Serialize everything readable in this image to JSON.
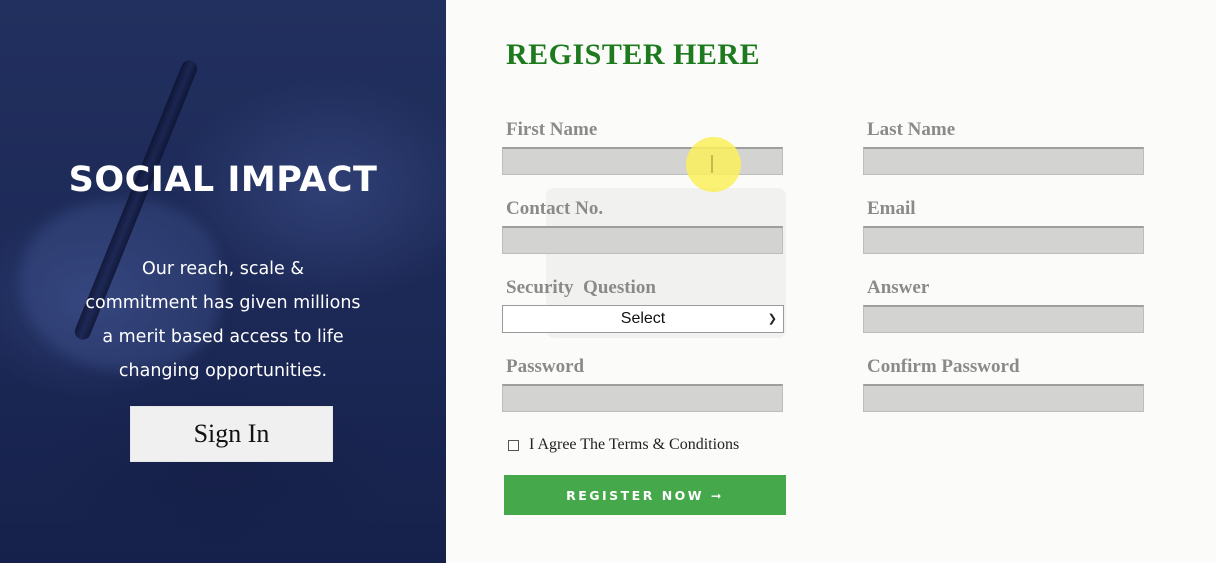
{
  "left_panel": {
    "title": "SOCIAL IMPACT",
    "tagline_lines": [
      "Our reach, scale &",
      "commitment has given millions",
      "a merit based access to life",
      "changing opportunities."
    ],
    "signin_label": "Sign In"
  },
  "form": {
    "heading": "REGISTER HERE",
    "fields": {
      "first_name": {
        "label": "First Name",
        "value": ""
      },
      "last_name": {
        "label": "Last Name",
        "value": ""
      },
      "contact": {
        "label": "Contact No.",
        "value": ""
      },
      "email": {
        "label": "Email",
        "value": ""
      },
      "security_question": {
        "label": "Security  Question",
        "selected": "Select"
      },
      "answer": {
        "label": "Answer",
        "value": ""
      },
      "password": {
        "label": "Password",
        "value": ""
      },
      "confirm_password": {
        "label": "Confirm Password",
        "value": ""
      }
    },
    "agree_label": "I Agree The Terms & Conditions",
    "agree_checked": false,
    "register_label": "REGISTER NOW ➞"
  },
  "colors": {
    "panel_blue": "#1d2a58",
    "heading_green": "#1e7a1e",
    "button_green": "#45a84b",
    "cursor_highlight": "#faee5a"
  }
}
